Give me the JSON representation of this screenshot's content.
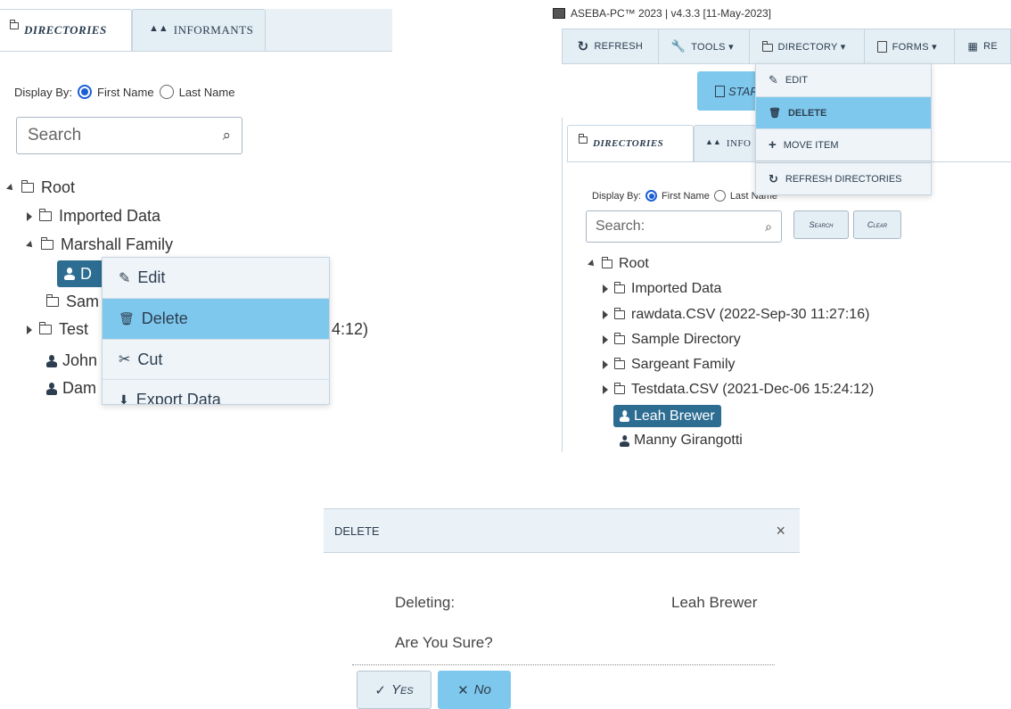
{
  "left": {
    "tabs": [
      {
        "label": "DIRECTORIES",
        "icon": "folder-icon"
      },
      {
        "label": "INFORMANTS",
        "icon": "people-icon"
      }
    ],
    "display_by_label": "Display By:",
    "option_first": "First Name",
    "option_last": "Last Name",
    "search_placeholder": "Search",
    "tree": {
      "root": "Root",
      "imported": "Imported Data",
      "marshall": "Marshall Family",
      "selected": "D",
      "sample": "Sam",
      "test": "Test",
      "test_suffix": "4:12)",
      "john": "John",
      "dam": "Dam"
    },
    "context_menu": [
      {
        "label": "Edit",
        "icon": "pencil-icon"
      },
      {
        "label": "Delete",
        "icon": "trash-icon"
      },
      {
        "label": "Cut",
        "icon": "scissors-icon"
      },
      {
        "label": "Export Data",
        "icon": "export-icon"
      }
    ]
  },
  "right": {
    "title": "ASEBA-PC™ 2023 | v4.3.3 [11-May-2023]",
    "toolbar": [
      {
        "label": "REFRESH",
        "icon": "refresh-icon"
      },
      {
        "label": "TOOLS ▾",
        "icon": "wrench-icon"
      },
      {
        "label": "DIRECTORY ▾",
        "icon": "folder-icon"
      },
      {
        "label": "FORMS ▾",
        "icon": "document-icon"
      },
      {
        "label": "RE",
        "icon": "table-icon"
      }
    ],
    "start_label": "STAR",
    "tabs": [
      {
        "label": "DIRECTORIES"
      },
      {
        "label": "INFO"
      }
    ],
    "directory_menu": [
      {
        "label": "EDIT",
        "icon": "pencil-icon"
      },
      {
        "label": "DELETE",
        "icon": "trash-icon"
      },
      {
        "label": "MOVE ITEM",
        "icon": "plus-icon"
      },
      {
        "label": "REFRESH DIRECTORIES",
        "icon": "refresh-icon"
      }
    ],
    "display_by_label": "Display By:",
    "option_first": "First Name",
    "option_last": "Last Name",
    "search_placeholder": "Search:",
    "search_button": "Search",
    "clear_button": "Clear",
    "tree": {
      "root": "Root",
      "items": [
        "Imported Data",
        "rawdata.CSV (2022-Sep-30 11:27:16)",
        "Sample Directory",
        "Sargeant Family",
        "Testdata.CSV (2021-Dec-06 15:24:12)"
      ],
      "selected": "Leah Brewer",
      "person2": "Manny Girangotti"
    }
  },
  "dialog": {
    "title": "DELETE",
    "close": "×",
    "deleting_label": "Deleting:",
    "deleting_value": "Leah Brewer",
    "question": "Are You Sure?",
    "yes": "Yes",
    "no": "No"
  },
  "colors": {
    "highlight": "#7fc8ed",
    "selected_node": "#2d6d92",
    "radio": "#1a5fd6"
  }
}
